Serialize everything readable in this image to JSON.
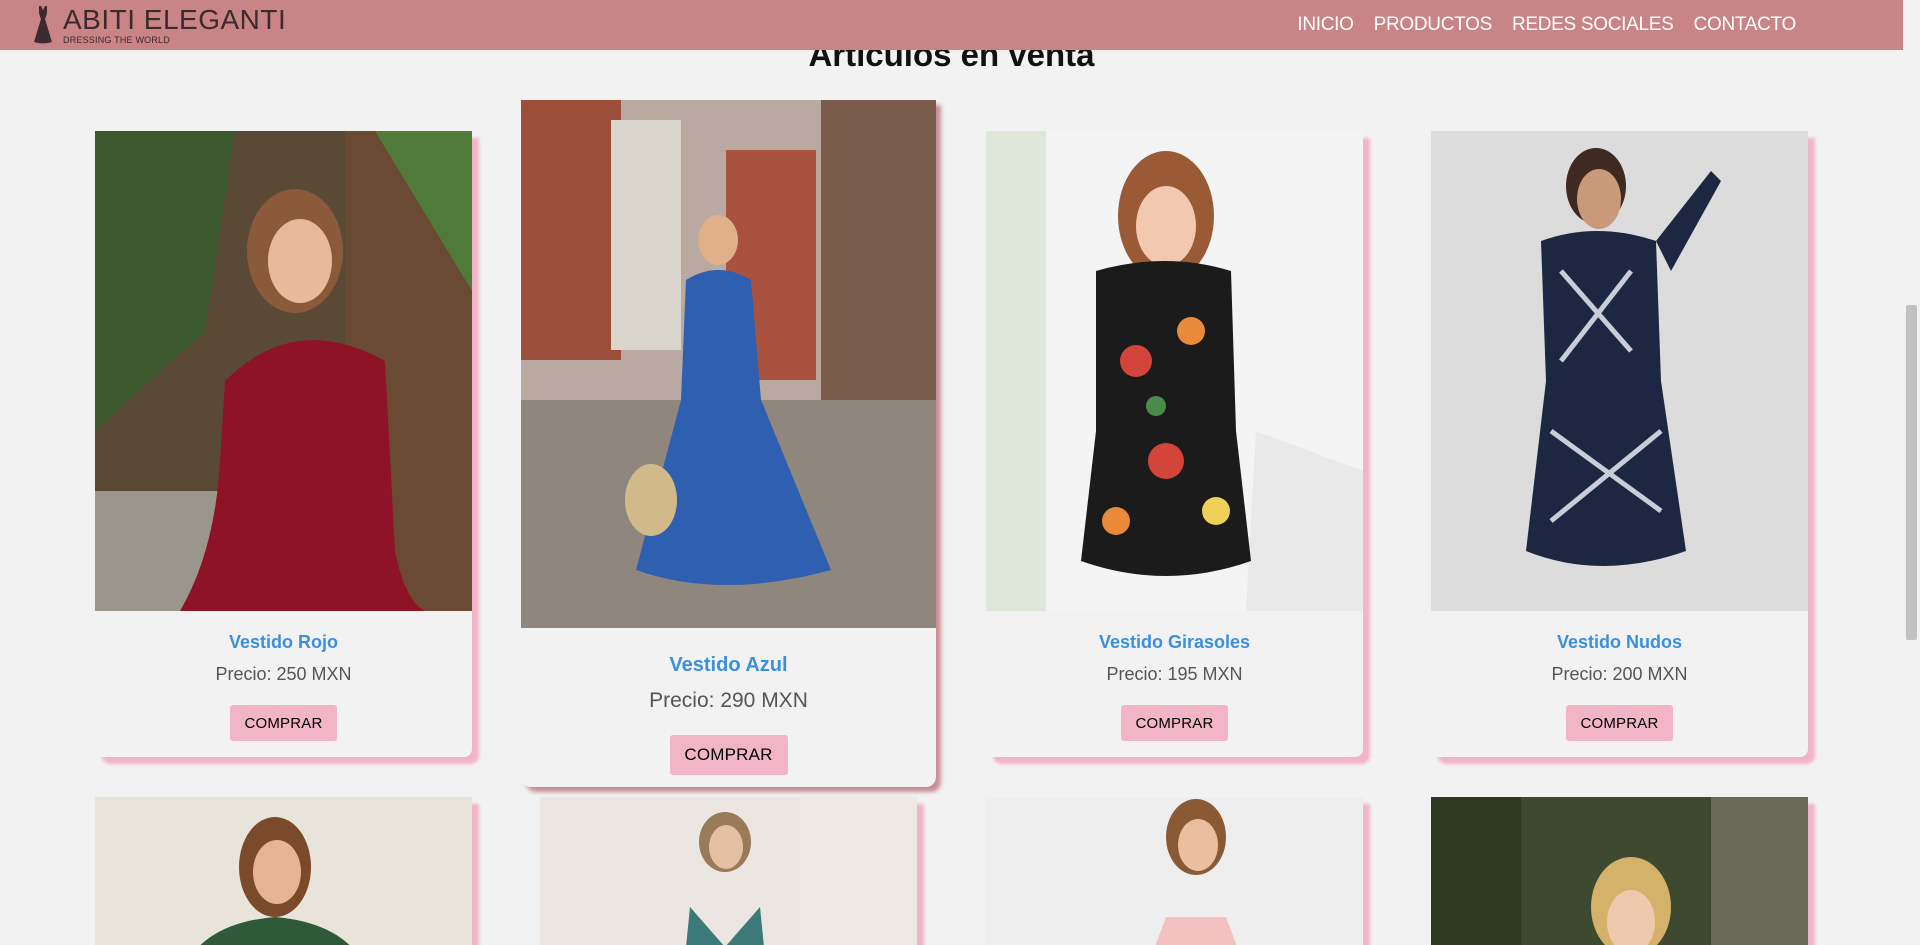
{
  "brand": {
    "name": "ABITI ELEGANTI",
    "tagline": "DRESSING THE WORLD"
  },
  "nav": {
    "items": [
      {
        "label": "INICIO"
      },
      {
        "label": "PRODUCTOS"
      },
      {
        "label": "REDES SOCIALES"
      },
      {
        "label": "CONTACTO"
      }
    ]
  },
  "section": {
    "title": "Artículos en venta"
  },
  "products": [
    {
      "name": "Vestido Rojo",
      "price": "Precio: 250 MXN",
      "button": "COMPRAR"
    },
    {
      "name": "Vestido Azul",
      "price": "Precio: 290 MXN",
      "button": "COMPRAR"
    },
    {
      "name": "Vestido Girasoles",
      "price": "Precio: 195 MXN",
      "button": "COMPRAR"
    },
    {
      "name": "Vestido Nudos",
      "price": "Precio: 200 MXN",
      "button": "COMPRAR"
    }
  ],
  "colors": {
    "header": "#c98585",
    "accent_pink": "#f2b5c8",
    "product_name": "#3b8fde",
    "background": "#f2f2f2"
  },
  "icons": {
    "logo": "dress-icon"
  }
}
